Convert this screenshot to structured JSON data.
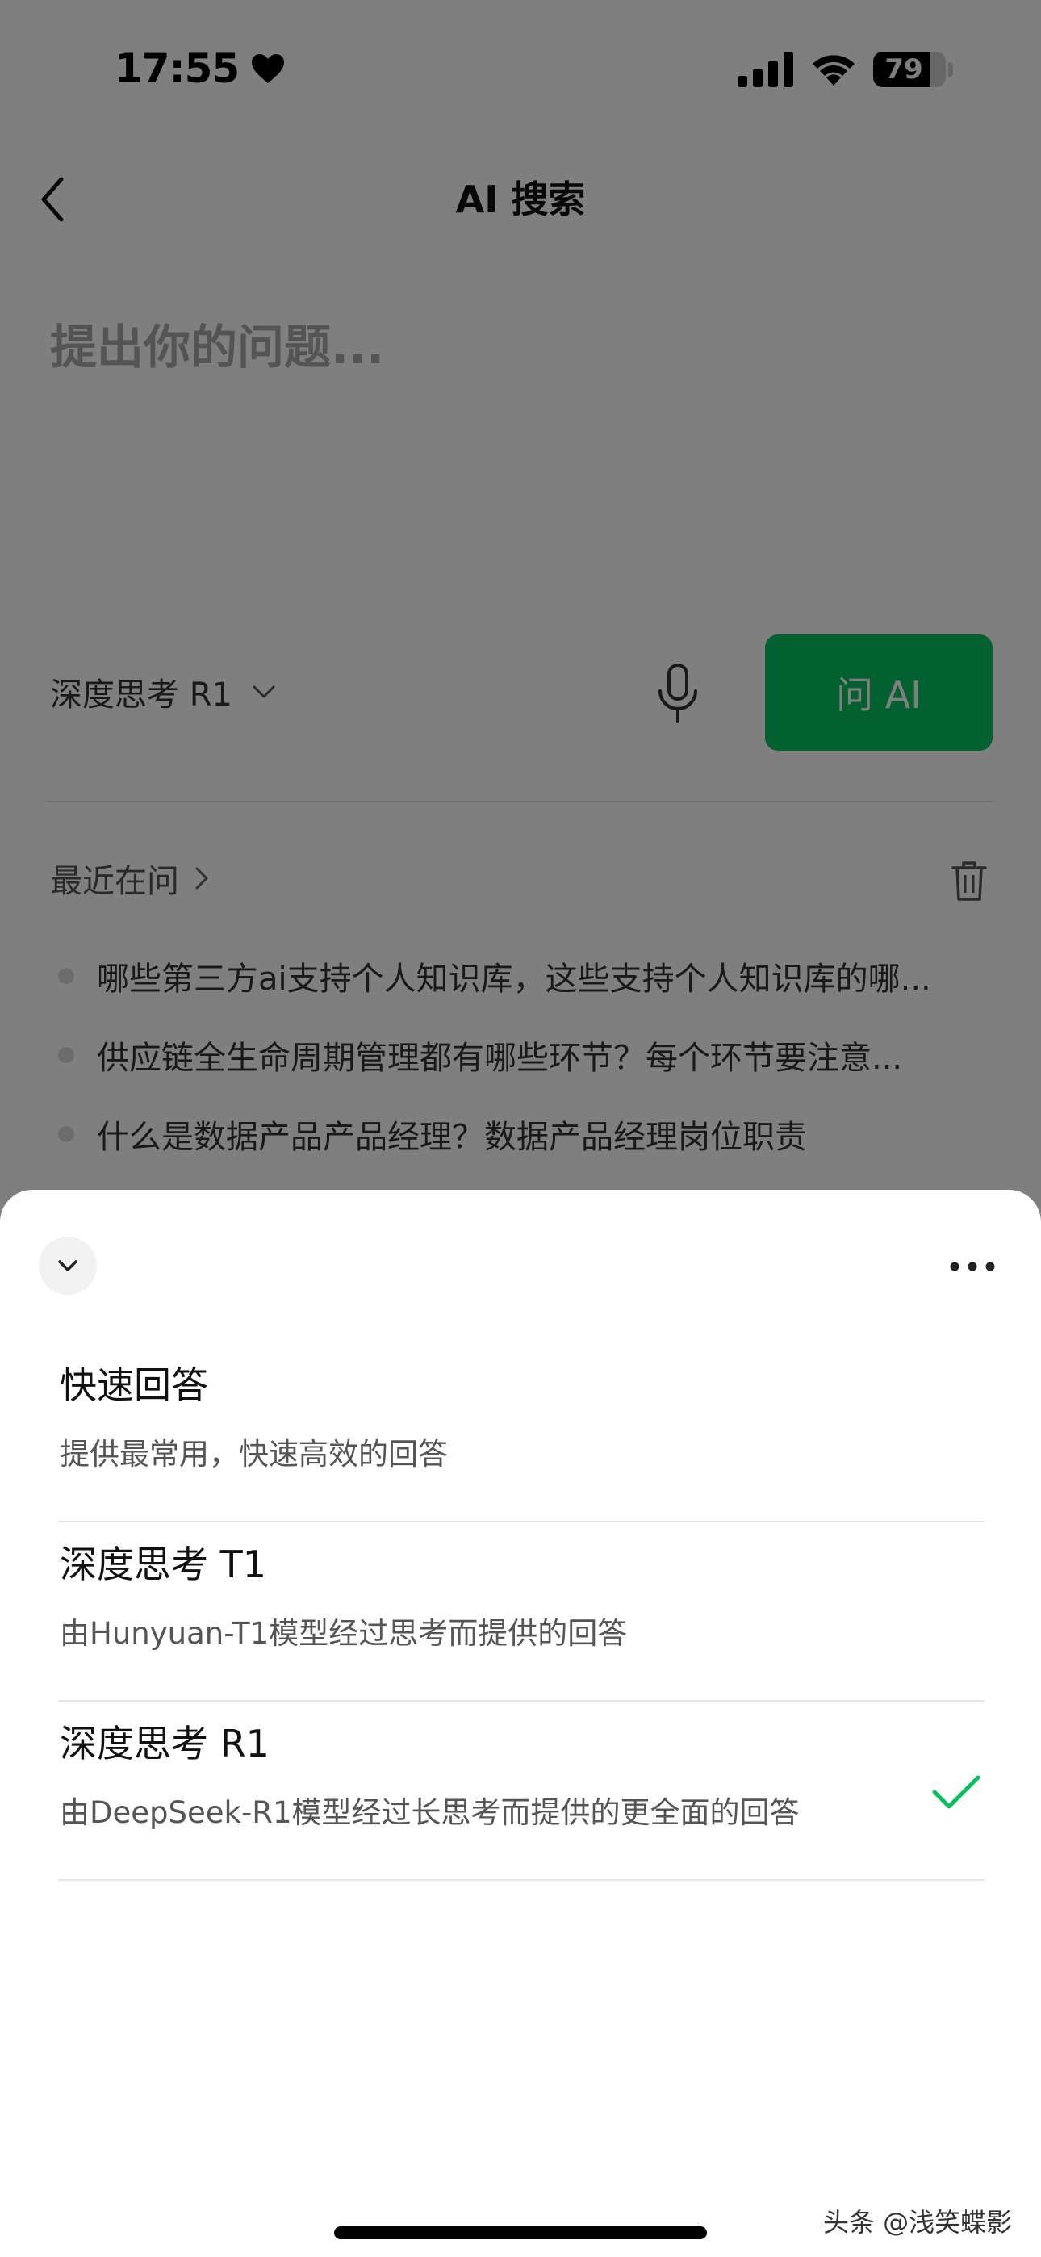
{
  "status_bar": {
    "time": "17:55",
    "battery_level": "79",
    "battery_fraction": 0.79
  },
  "header": {
    "title": "AI 搜索"
  },
  "question": {
    "placeholder": "提出你的问题..."
  },
  "controls": {
    "model_label": "深度思考 R1",
    "ask_button": "问 AI",
    "accent_color": "#07c160"
  },
  "recent": {
    "title": "最近在问",
    "items": [
      "哪些第三方ai支持个人知识库，这些支持个人知识库的哪...",
      "供应链全生命周期管理都有哪些环节？每个环节要注意...",
      "什么是数据产品产品经理？数据产品经理岗位职责"
    ]
  },
  "sheet": {
    "options": [
      {
        "title": "快速回答",
        "description": "提供最常用，快速高效的回答",
        "selected": false
      },
      {
        "title": "深度思考 T1",
        "description": "由Hunyuan-T1模型经过思考而提供的回答",
        "selected": false
      },
      {
        "title": "深度思考 R1",
        "description": "由DeepSeek-R1模型经过长思考而提供的更全面的回答",
        "selected": true
      }
    ]
  },
  "watermark": "头条 @浅笑蝶影",
  "icons": [
    "heart-icon",
    "signal-icon",
    "wifi-icon",
    "battery-icon",
    "back-icon",
    "chevron-down-icon",
    "mic-icon",
    "chevron-right-icon",
    "trash-icon",
    "more-icon",
    "check-icon"
  ]
}
